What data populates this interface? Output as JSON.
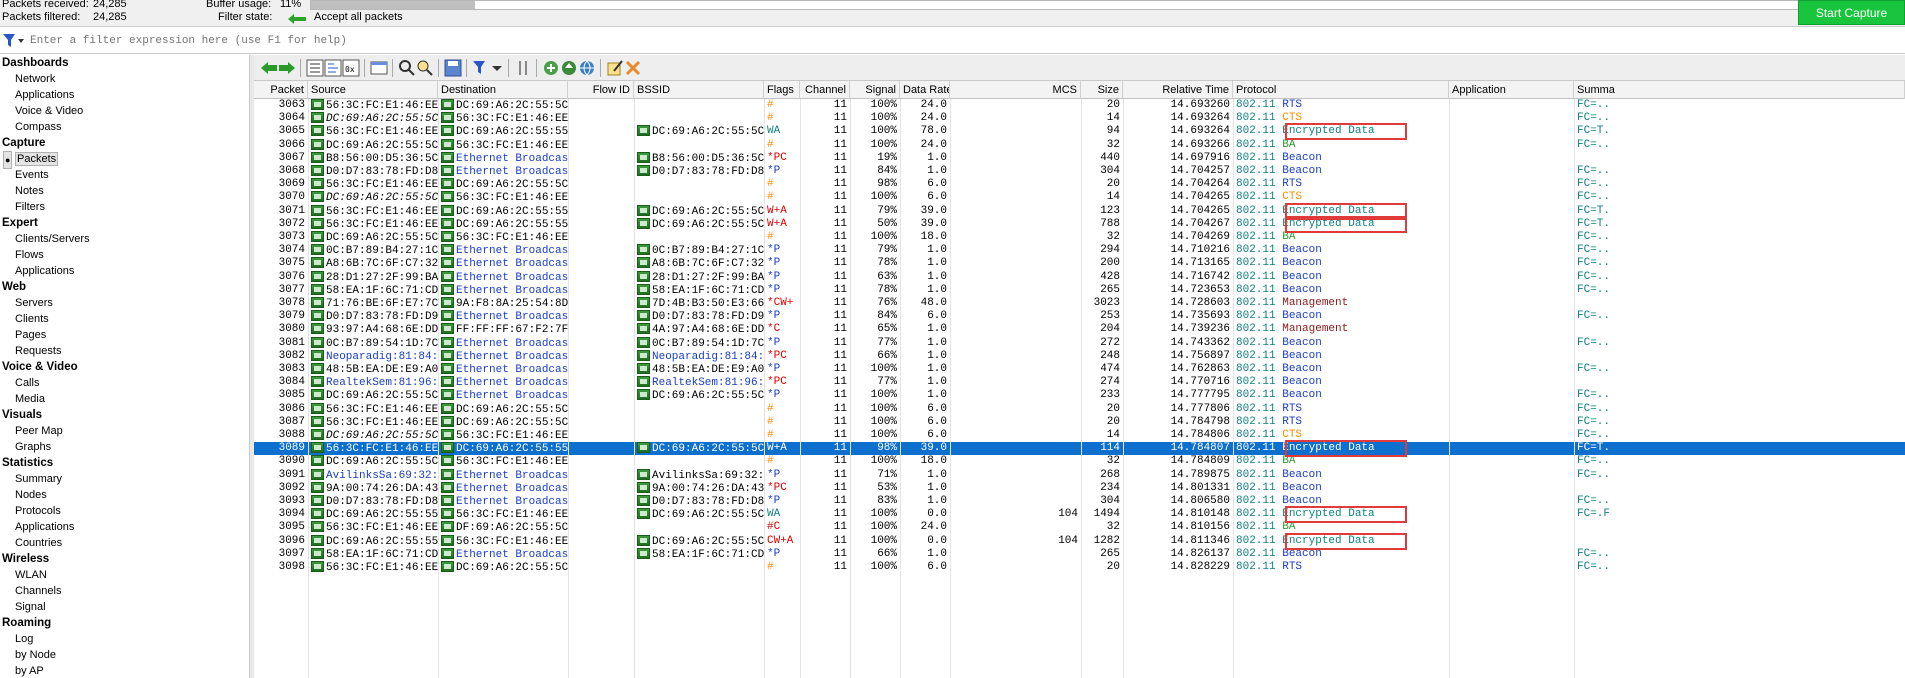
{
  "stats": {
    "packets_received_label": "Packets received:",
    "packets_received": "24,285",
    "packets_filtered_label": "Packets filtered:",
    "packets_filtered": "24,285",
    "buffer_usage_label": "Buffer usage:",
    "buffer_usage": "11%",
    "buffer_fraction": 0.11,
    "filter_state_label": "Filter state:",
    "filter_state": "Accept all packets",
    "start_capture": "Start Capture"
  },
  "filter": {
    "placeholder": "Enter a filter expression here (use F1 for help)"
  },
  "sidebar": [
    {
      "section": "Dashboards",
      "items": [
        "Network",
        "Applications",
        "Voice & Video",
        "Compass"
      ]
    },
    {
      "section": "Capture",
      "items": [
        "Packets",
        "Events",
        "Notes",
        "Filters"
      ]
    },
    {
      "section": "Expert",
      "items": [
        "Clients/Servers",
        "Flows",
        "Applications"
      ]
    },
    {
      "section": "Web",
      "items": [
        "Servers",
        "Clients",
        "Pages",
        "Requests"
      ]
    },
    {
      "section": "Voice & Video",
      "items": [
        "Calls",
        "Media"
      ]
    },
    {
      "section": "Visuals",
      "items": [
        "Peer Map",
        "Graphs"
      ]
    },
    {
      "section": "Statistics",
      "items": [
        "Summary",
        "Nodes",
        "Protocols",
        "Applications",
        "Countries"
      ]
    },
    {
      "section": "Wireless",
      "items": [
        "WLAN",
        "Channels",
        "Signal"
      ]
    },
    {
      "section": "Roaming",
      "items": [
        "Log",
        "by Node",
        "by AP"
      ]
    }
  ],
  "active_item": "Packets",
  "columns": [
    "Packet",
    "Source",
    "Destination",
    "Flow ID",
    "BSSID",
    "Flags",
    "Channel",
    "Signal",
    "Data Rate",
    "MCS",
    "Size",
    "Relative Time",
    "Protocol",
    "Application",
    "Summa"
  ],
  "colors": {
    "blue_text": "#1a3cc8",
    "orange_flag": "#ff8c00",
    "red_flag": "#e00000",
    "teal": "#108080",
    "green_ba": "#2e9a2e",
    "brown_mgmt": "#8b1a1a",
    "selection": "#0d6fce",
    "highlight_box": "#e03a3a"
  },
  "rows": [
    {
      "packet": "3063",
      "src": "56:3C:FC:E1:46:EE",
      "src_i": false,
      "dst": "DC:69:A6:2C:55:5C",
      "dst_b": false,
      "bssid": "",
      "flags": "#",
      "fc": "orange",
      "ch": "11",
      "sig": "100%",
      "rate": "24.0",
      "mcs": "",
      "size": "20",
      "time": "14.693260",
      "proto": "802.11",
      "ptype": "RTS",
      "pc": "blue",
      "summ": "FC=.."
    },
    {
      "packet": "3064",
      "src": "DC:69:A6:2C:55:5C",
      "src_i": true,
      "dst": "56:3C:FC:E1:46:EE",
      "dst_b": false,
      "bssid": "",
      "flags": "#",
      "fc": "orange",
      "ch": "11",
      "sig": "100%",
      "rate": "24.0",
      "mcs": "",
      "size": "14",
      "time": "14.693264",
      "proto": "802.11",
      "ptype": "CTS",
      "pc": "orange",
      "summ": "FC=.."
    },
    {
      "packet": "3065",
      "src": "56:3C:FC:E1:46:EE",
      "src_i": false,
      "dst": "DC:69:A6:2C:55:55",
      "dst_b": false,
      "bssid": "DC:69:A6:2C:55:5C",
      "flags": "WA",
      "fc": "teal",
      "ch": "11",
      "sig": "100%",
      "rate": "78.0",
      "mcs": "",
      "size": "94",
      "time": "14.693264",
      "proto": "802.11",
      "ptype": "Encrypted Data",
      "pc": "teal",
      "summ": "FC=T."
    },
    {
      "packet": "3066",
      "src": "DC:69:A6:2C:55:5C",
      "src_i": false,
      "dst": "56:3C:FC:E1:46:EE",
      "dst_b": false,
      "bssid": "",
      "flags": "#",
      "fc": "orange",
      "ch": "11",
      "sig": "100%",
      "rate": "24.0",
      "mcs": "",
      "size": "32",
      "time": "14.693266",
      "proto": "802.11",
      "ptype": "BA",
      "pc": "green",
      "summ": "FC=.."
    },
    {
      "packet": "3067",
      "src": "B8:56:00:D5:36:5C",
      "src_i": false,
      "dst": "Ethernet Broadcast",
      "dst_b": true,
      "bssid": "B8:56:00:D5:36:5C",
      "flags": "*PC",
      "fc": "red",
      "ch": "11",
      "sig": "19%",
      "rate": "1.0",
      "mcs": "",
      "size": "440",
      "time": "14.697916",
      "proto": "802.11",
      "ptype": "Beacon",
      "pc": "blue",
      "summ": ""
    },
    {
      "packet": "3068",
      "src": "D0:D7:83:78:FD:D8",
      "src_i": false,
      "dst": "Ethernet Broadcast",
      "dst_b": true,
      "bssid": "D0:D7:83:78:FD:D8",
      "flags": "*P",
      "fc": "blue",
      "ch": "11",
      "sig": "84%",
      "rate": "1.0",
      "mcs": "",
      "size": "304",
      "time": "14.704257",
      "proto": "802.11",
      "ptype": "Beacon",
      "pc": "blue",
      "summ": "FC=.."
    },
    {
      "packet": "3069",
      "src": "56:3C:FC:E1:46:EE",
      "src_i": false,
      "dst": "DC:69:A6:2C:55:5C",
      "dst_b": false,
      "bssid": "",
      "flags": "#",
      "fc": "orange",
      "ch": "11",
      "sig": "98%",
      "rate": "6.0",
      "mcs": "",
      "size": "20",
      "time": "14.704264",
      "proto": "802.11",
      "ptype": "RTS",
      "pc": "blue",
      "summ": "FC=.."
    },
    {
      "packet": "3070",
      "src": "DC:69:A6:2C:55:5C",
      "src_i": true,
      "dst": "56:3C:FC:E1:46:EE",
      "dst_b": false,
      "bssid": "",
      "flags": "#",
      "fc": "orange",
      "ch": "11",
      "sig": "100%",
      "rate": "6.0",
      "mcs": "",
      "size": "14",
      "time": "14.704265",
      "proto": "802.11",
      "ptype": "CTS",
      "pc": "orange",
      "summ": "FC=.."
    },
    {
      "packet": "3071",
      "src": "56:3C:FC:E1:46:EE",
      "src_i": false,
      "dst": "DC:69:A6:2C:55:55",
      "dst_b": false,
      "bssid": "DC:69:A6:2C:55:5C",
      "flags": "W+A",
      "fc": "red",
      "ch": "11",
      "sig": "79%",
      "rate": "39.0",
      "mcs": "",
      "size": "123",
      "time": "14.704265",
      "proto": "802.11",
      "ptype": "Encrypted Data",
      "pc": "teal",
      "summ": "FC=T."
    },
    {
      "packet": "3072",
      "src": "56:3C:FC:E1:46:EE",
      "src_i": false,
      "dst": "DC:69:A6:2C:55:55",
      "dst_b": false,
      "bssid": "DC:69:A6:2C:55:5C",
      "flags": "W+A",
      "fc": "red",
      "ch": "11",
      "sig": "50%",
      "rate": "39.0",
      "mcs": "",
      "size": "788",
      "time": "14.704267",
      "proto": "802.11",
      "ptype": "Encrypted Data",
      "pc": "teal",
      "summ": "FC=T."
    },
    {
      "packet": "3073",
      "src": "DC:69:A6:2C:55:5C",
      "src_i": false,
      "dst": "56:3C:FC:E1:46:EE",
      "dst_b": false,
      "bssid": "",
      "flags": "#",
      "fc": "orange",
      "ch": "11",
      "sig": "100%",
      "rate": "18.0",
      "mcs": "",
      "size": "32",
      "time": "14.704269",
      "proto": "802.11",
      "ptype": "BA",
      "pc": "green",
      "summ": "FC=.."
    },
    {
      "packet": "3074",
      "src": "0C:B7:89:B4:27:1C",
      "src_i": false,
      "dst": "Ethernet Broadcast",
      "dst_b": true,
      "bssid": "0C:B7:89:B4:27:1C",
      "flags": "*P",
      "fc": "blue",
      "ch": "11",
      "sig": "79%",
      "rate": "1.0",
      "mcs": "",
      "size": "294",
      "time": "14.710216",
      "proto": "802.11",
      "ptype": "Beacon",
      "pc": "blue",
      "summ": "FC=.."
    },
    {
      "packet": "3075",
      "src": "A8:6B:7C:6F:C7:32",
      "src_i": false,
      "dst": "Ethernet Broadcast",
      "dst_b": true,
      "bssid": "A8:6B:7C:6F:C7:32",
      "flags": "*P",
      "fc": "blue",
      "ch": "11",
      "sig": "78%",
      "rate": "1.0",
      "mcs": "",
      "size": "200",
      "time": "14.713165",
      "proto": "802.11",
      "ptype": "Beacon",
      "pc": "blue",
      "summ": "FC=.."
    },
    {
      "packet": "3076",
      "src": "28:D1:27:2F:99:BA",
      "src_i": false,
      "dst": "Ethernet Broadcast",
      "dst_b": true,
      "bssid": "28:D1:27:2F:99:BA",
      "flags": "*P",
      "fc": "blue",
      "ch": "11",
      "sig": "63%",
      "rate": "1.0",
      "mcs": "",
      "size": "428",
      "time": "14.716742",
      "proto": "802.11",
      "ptype": "Beacon",
      "pc": "blue",
      "summ": "FC=.."
    },
    {
      "packet": "3077",
      "src": "58:EA:1F:6C:71:CD",
      "src_i": false,
      "dst": "Ethernet Broadcast",
      "dst_b": true,
      "bssid": "58:EA:1F:6C:71:CD",
      "flags": "*P",
      "fc": "blue",
      "ch": "11",
      "sig": "78%",
      "rate": "1.0",
      "mcs": "",
      "size": "265",
      "time": "14.723653",
      "proto": "802.11",
      "ptype": "Beacon",
      "pc": "blue",
      "summ": "FC=.."
    },
    {
      "packet": "3078",
      "src": "71:76:BE:6F:E7:7C",
      "src_i": false,
      "dst": "9A:F8:8A:25:54:8D",
      "dst_b": false,
      "bssid": "7D:4B:B3:50:E3:66",
      "flags": "*CW+",
      "fc": "red",
      "ch": "11",
      "sig": "76%",
      "rate": "48.0",
      "mcs": "",
      "size": "3023",
      "time": "14.728603",
      "proto": "802.11",
      "ptype": "Management",
      "pc": "brown",
      "summ": ""
    },
    {
      "packet": "3079",
      "src": "D0:D7:83:78:FD:D9",
      "src_i": false,
      "dst": "Ethernet Broadcast",
      "dst_b": true,
      "bssid": "D0:D7:83:78:FD:D9",
      "flags": "*P",
      "fc": "blue",
      "ch": "11",
      "sig": "84%",
      "rate": "6.0",
      "mcs": "",
      "size": "253",
      "time": "14.735693",
      "proto": "802.11",
      "ptype": "Beacon",
      "pc": "blue",
      "summ": "FC=.."
    },
    {
      "packet": "3080",
      "src": "93:97:A4:68:6E:DD",
      "src_i": false,
      "dst": "FF:FF:FF:67:F2:7F",
      "dst_b": false,
      "bssid": "4A:97:A4:68:6E:DD",
      "flags": "*C",
      "fc": "red",
      "ch": "11",
      "sig": "65%",
      "rate": "1.0",
      "mcs": "",
      "size": "204",
      "time": "14.739236",
      "proto": "802.11",
      "ptype": "Management",
      "pc": "brown",
      "summ": ""
    },
    {
      "packet": "3081",
      "src": "0C:B7:89:54:1D:7C",
      "src_i": false,
      "dst": "Ethernet Broadcast",
      "dst_b": true,
      "bssid": "0C:B7:89:54:1D:7C",
      "flags": "*P",
      "fc": "blue",
      "ch": "11",
      "sig": "77%",
      "rate": "1.0",
      "mcs": "",
      "size": "272",
      "time": "14.743362",
      "proto": "802.11",
      "ptype": "Beacon",
      "pc": "blue",
      "summ": "FC=.."
    },
    {
      "packet": "3082",
      "src": "Neoparadig:81:84:62",
      "src_i": false,
      "src_b": true,
      "dst": "Ethernet Broadcast",
      "dst_b": true,
      "bssid": "Neoparadig:81:84:62",
      "bssid_b": true,
      "flags": "*PC",
      "fc": "red",
      "ch": "11",
      "sig": "66%",
      "rate": "1.0",
      "mcs": "",
      "size": "248",
      "time": "14.756897",
      "proto": "802.11",
      "ptype": "Beacon",
      "pc": "blue",
      "summ": ""
    },
    {
      "packet": "3083",
      "src": "48:5B:EA:DE:E9:A0",
      "src_i": false,
      "dst": "Ethernet Broadcast",
      "dst_b": true,
      "bssid": "48:5B:EA:DE:E9:A0",
      "flags": "*P",
      "fc": "blue",
      "ch": "11",
      "sig": "100%",
      "rate": "1.0",
      "mcs": "",
      "size": "474",
      "time": "14.762863",
      "proto": "802.11",
      "ptype": "Beacon",
      "pc": "blue",
      "summ": "FC=.."
    },
    {
      "packet": "3084",
      "src": "RealtekSem:81:96:C1",
      "src_i": false,
      "src_b": true,
      "dst": "Ethernet Broadcast",
      "dst_b": true,
      "bssid": "RealtekSem:81:96:C1",
      "bssid_b": true,
      "flags": "*PC",
      "fc": "red",
      "ch": "11",
      "sig": "77%",
      "rate": "1.0",
      "mcs": "",
      "size": "274",
      "time": "14.770716",
      "proto": "802.11",
      "ptype": "Beacon",
      "pc": "blue",
      "summ": ""
    },
    {
      "packet": "3085",
      "src": "DC:69:A6:2C:55:5C",
      "src_i": false,
      "dst": "Ethernet Broadcast",
      "dst_b": true,
      "bssid": "DC:69:A6:2C:55:5C",
      "flags": "*P",
      "fc": "blue",
      "ch": "11",
      "sig": "100%",
      "rate": "1.0",
      "mcs": "",
      "size": "233",
      "time": "14.777795",
      "proto": "802.11",
      "ptype": "Beacon",
      "pc": "blue",
      "summ": "FC=.."
    },
    {
      "packet": "3086",
      "src": "56:3C:FC:E1:46:EE",
      "src_i": false,
      "dst": "DC:69:A6:2C:55:5C",
      "dst_b": false,
      "bssid": "",
      "flags": "#",
      "fc": "orange",
      "ch": "11",
      "sig": "100%",
      "rate": "6.0",
      "mcs": "",
      "size": "20",
      "time": "14.777806",
      "proto": "802.11",
      "ptype": "RTS",
      "pc": "blue",
      "summ": "FC=.."
    },
    {
      "packet": "3087",
      "src": "56:3C:FC:E1:46:EE",
      "src_i": false,
      "dst": "DC:69:A6:2C:55:5C",
      "dst_b": false,
      "bssid": "",
      "flags": "#",
      "fc": "orange",
      "ch": "11",
      "sig": "100%",
      "rate": "6.0",
      "mcs": "",
      "size": "20",
      "time": "14.784798",
      "proto": "802.11",
      "ptype": "RTS",
      "pc": "blue",
      "summ": "FC=.."
    },
    {
      "packet": "3088",
      "src": "DC:69:A6:2C:55:5C",
      "src_i": true,
      "dst": "56:3C:FC:E1:46:EE",
      "dst_b": false,
      "bssid": "",
      "flags": "#",
      "fc": "orange",
      "ch": "11",
      "sig": "100%",
      "rate": "6.0",
      "mcs": "",
      "size": "14",
      "time": "14.784806",
      "proto": "802.11",
      "ptype": "CTS",
      "pc": "orange",
      "summ": "FC=.."
    },
    {
      "packet": "3089",
      "src": "56:3C:FC:E1:46:EE",
      "src_i": false,
      "dst": "DC:69:A6:2C:55:55",
      "dst_b": false,
      "bssid": "DC:69:A6:2C:55:5C",
      "flags": "W+A",
      "fc": "red",
      "ch": "11",
      "sig": "98%",
      "rate": "39.0",
      "mcs": "",
      "size": "114",
      "time": "14.784807",
      "proto": "802.11",
      "ptype": "Encrypted Data",
      "pc": "teal",
      "summ": "FC=T.",
      "selected": true
    },
    {
      "packet": "3090",
      "src": "DC:69:A6:2C:55:5C",
      "src_i": false,
      "dst": "56:3C:FC:E1:46:EE",
      "dst_b": false,
      "bssid": "",
      "flags": "#",
      "fc": "orange",
      "ch": "11",
      "sig": "100%",
      "rate": "18.0",
      "mcs": "",
      "size": "32",
      "time": "14.784809",
      "proto": "802.11",
      "ptype": "BA",
      "pc": "green",
      "summ": "FC=.."
    },
    {
      "packet": "3091",
      "src": "AvilinksSa:69:32:09",
      "src_i": false,
      "src_b": true,
      "dst": "Ethernet Broadcast",
      "dst_b": true,
      "bssid": "AvilinksSa:69:32:09",
      "flags": "*P",
      "fc": "blue",
      "ch": "11",
      "sig": "71%",
      "rate": "1.0",
      "mcs": "",
      "size": "268",
      "time": "14.789875",
      "proto": "802.11",
      "ptype": "Beacon",
      "pc": "blue",
      "summ": "FC=.."
    },
    {
      "packet": "3092",
      "src": "9A:00:74:26:DA:43",
      "src_i": false,
      "dst": "Ethernet Broadcast",
      "dst_b": true,
      "bssid": "9A:00:74:26:DA:43",
      "flags": "*PC",
      "fc": "red",
      "ch": "11",
      "sig": "53%",
      "rate": "1.0",
      "mcs": "",
      "size": "234",
      "time": "14.801331",
      "proto": "802.11",
      "ptype": "Beacon",
      "pc": "blue",
      "summ": ""
    },
    {
      "packet": "3093",
      "src": "D0:D7:83:78:FD:D8",
      "src_i": false,
      "dst": "Ethernet Broadcast",
      "dst_b": true,
      "bssid": "D0:D7:83:78:FD:D8",
      "flags": "*P",
      "fc": "blue",
      "ch": "11",
      "sig": "83%",
      "rate": "1.0",
      "mcs": "",
      "size": "304",
      "time": "14.806580",
      "proto": "802.11",
      "ptype": "Beacon",
      "pc": "blue",
      "summ": "FC=.."
    },
    {
      "packet": "3094",
      "src": "DC:69:A6:2C:55:55",
      "src_i": false,
      "dst": "56:3C:FC:E1:46:EE",
      "dst_b": false,
      "bssid": "DC:69:A6:2C:55:5C",
      "flags": "WA",
      "fc": "teal",
      "ch": "11",
      "sig": "100%",
      "rate": "0.0",
      "mcs": "104",
      "size": "1494",
      "time": "14.810148",
      "proto": "802.11",
      "ptype": "Encrypted Data",
      "pc": "teal",
      "summ": "FC=.F"
    },
    {
      "packet": "3095",
      "src": "56:3C:FC:E1:46:EE",
      "src_i": false,
      "dst": "DF:69:A6:2C:55:5C",
      "dst_b": false,
      "bssid": "",
      "flags": "#C",
      "fc": "red",
      "ch": "11",
      "sig": "100%",
      "rate": "24.0",
      "mcs": "",
      "size": "32",
      "time": "14.810156",
      "proto": "802.11",
      "ptype": "BA",
      "pc": "green",
      "summ": ""
    },
    {
      "packet": "3096",
      "src": "DC:69:A6:2C:55:55",
      "src_i": false,
      "dst": "56:3C:FC:E1:46:EE",
      "dst_b": false,
      "bssid": "DC:69:A6:2C:55:5C",
      "flags": "CW+A",
      "fc": "red",
      "ch": "11",
      "sig": "100%",
      "rate": "0.0",
      "mcs": "104",
      "size": "1282",
      "time": "14.811346",
      "proto": "802.11",
      "ptype": "Encrypted Data",
      "pc": "teal",
      "summ": ""
    },
    {
      "packet": "3097",
      "src": "58:EA:1F:6C:71:CD",
      "src_i": false,
      "dst": "Ethernet Broadcast",
      "dst_b": true,
      "bssid": "58:EA:1F:6C:71:CD",
      "flags": "*P",
      "fc": "blue",
      "ch": "11",
      "sig": "66%",
      "rate": "1.0",
      "mcs": "",
      "size": "265",
      "time": "14.826137",
      "proto": "802.11",
      "ptype": "Beacon",
      "pc": "blue",
      "summ": "FC=.."
    },
    {
      "packet": "3098",
      "src": "56:3C:FC:E1:46:EE",
      "src_i": false,
      "dst": "DC:69:A6:2C:55:5C",
      "dst_b": false,
      "bssid": "",
      "flags": "#",
      "fc": "orange",
      "ch": "11",
      "sig": "100%",
      "rate": "6.0",
      "mcs": "",
      "size": "20",
      "time": "14.828229",
      "proto": "802.11",
      "ptype": "RTS",
      "pc": "blue",
      "summ": "FC=.."
    }
  ]
}
